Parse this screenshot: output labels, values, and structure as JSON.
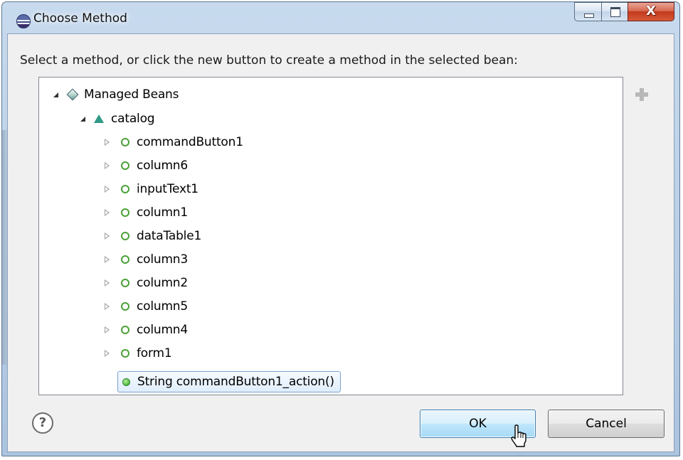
{
  "window": {
    "title": "Choose Method",
    "close_symbol": "X"
  },
  "dialog": {
    "instruction": "Select a method, or click the new button to create a method in the selected bean:"
  },
  "tree": {
    "root": {
      "label": "Managed Beans",
      "icon": "diamond-icon",
      "expanded": true
    },
    "bean": {
      "label": "catalog",
      "icon": "bean-triangle-icon",
      "expanded": true
    },
    "fields": [
      {
        "label": "commandButton1"
      },
      {
        "label": "column6"
      },
      {
        "label": "inputText1"
      },
      {
        "label": "column1"
      },
      {
        "label": "dataTable1"
      },
      {
        "label": "column3"
      },
      {
        "label": "column2"
      },
      {
        "label": "column5"
      },
      {
        "label": "column4"
      },
      {
        "label": "form1"
      }
    ],
    "method": {
      "label": "String commandButton1_action()",
      "selected": true
    }
  },
  "buttons": {
    "help": "?",
    "ok": "OK",
    "cancel": "Cancel"
  },
  "colors": {
    "titlebar": "#bcd1e8",
    "close_button": "#c7432a",
    "ok_button": "#bee6fd",
    "selection_border": "#7da2ce",
    "field_icon": "#4aa136",
    "bean_icon": "#2f9a86"
  }
}
